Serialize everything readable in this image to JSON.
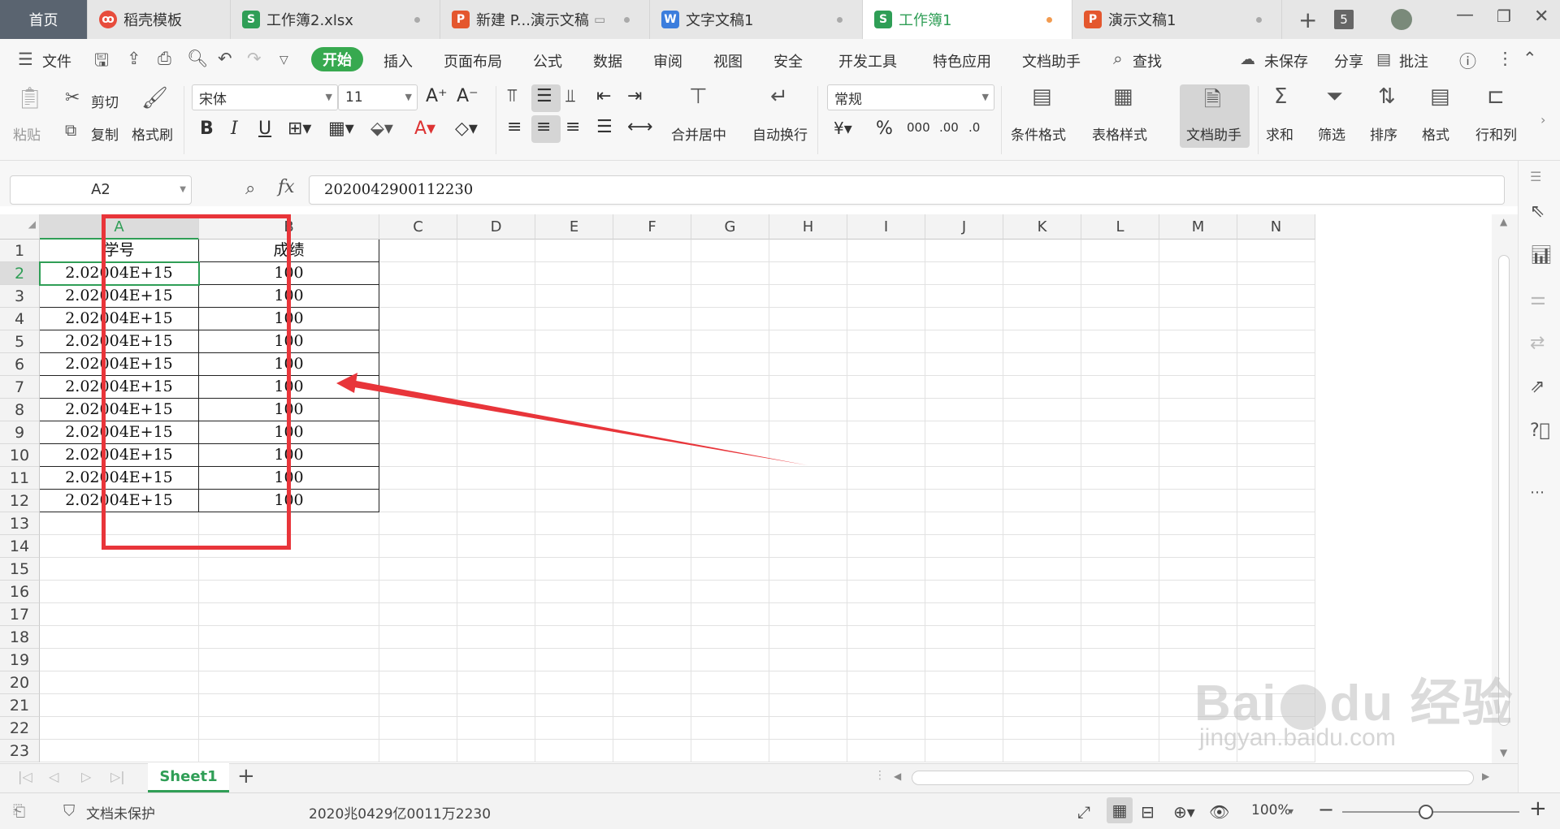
{
  "tabs": [
    {
      "label": "首页",
      "icon": ""
    },
    {
      "label": "稻壳模板",
      "icon": "docer-icon",
      "color": "#e74c3c"
    },
    {
      "label": "工作簿2.xlsx",
      "icon": "S",
      "color": "#2f9e56"
    },
    {
      "label": "新建 P...演示文稿",
      "icon": "P",
      "color": "#e4572e"
    },
    {
      "label": "文字文稿1",
      "icon": "W",
      "color": "#3b7ddd"
    },
    {
      "label": "工作簿1",
      "icon": "S",
      "color": "#2f9e56"
    },
    {
      "label": "演示文稿1",
      "icon": "P",
      "color": "#e4572e"
    }
  ],
  "tab_count": "5",
  "menu": {
    "file": "文件",
    "items": [
      "开始",
      "插入",
      "页面布局",
      "公式",
      "数据",
      "审阅",
      "视图",
      "安全",
      "开发工具",
      "特色应用",
      "文档助手"
    ],
    "search": "查找",
    "unsaved": "未保存",
    "share": "分享",
    "comment": "批注"
  },
  "ribbon": {
    "paste": "粘贴",
    "cut": "剪切",
    "copy": "复制",
    "format_painter": "格式刷",
    "font_name": "宋体",
    "font_size": "11",
    "merge_center": "合并居中",
    "wrap_text": "自动换行",
    "number_format": "常规",
    "conditional_format": "条件格式",
    "table_style": "表格样式",
    "doc_assistant": "文档助手",
    "sum": "求和",
    "filter": "筛选",
    "sort": "排序",
    "format": "格式",
    "rows_cols": "行和列"
  },
  "formula": {
    "name_box": "A2",
    "fx": "fx",
    "value": "2020042900112230"
  },
  "columns": [
    "A",
    "B",
    "C",
    "D",
    "E",
    "F",
    "G",
    "H",
    "I",
    "J",
    "K",
    "L",
    "M",
    "N"
  ],
  "rows": [
    "1",
    "2",
    "3",
    "4",
    "5",
    "6",
    "7",
    "8",
    "9",
    "10",
    "11",
    "12",
    "13",
    "14",
    "15",
    "16",
    "17",
    "18",
    "19",
    "20",
    "21",
    "22",
    "23"
  ],
  "table": {
    "headers": [
      "学号",
      "成绩"
    ],
    "values": [
      [
        "2.02004E+15",
        "100"
      ],
      [
        "2.02004E+15",
        "100"
      ],
      [
        "2.02004E+15",
        "100"
      ],
      [
        "2.02004E+15",
        "100"
      ],
      [
        "2.02004E+15",
        "100"
      ],
      [
        "2.02004E+15",
        "100"
      ],
      [
        "2.02004E+15",
        "100"
      ],
      [
        "2.02004E+15",
        "100"
      ],
      [
        "2.02004E+15",
        "100"
      ],
      [
        "2.02004E+15",
        "100"
      ],
      [
        "2.02004E+15",
        "100"
      ]
    ]
  },
  "sheet": {
    "name": "Sheet1"
  },
  "status": {
    "protection": "文档未保护",
    "readout": "2020兆0429亿0011万2230",
    "zoom": "100%"
  },
  "watermark": {
    "logo": "Baidu 经验",
    "url": "jingyan.baidu.com"
  },
  "colors": {
    "accent": "#2f9e56",
    "annotation": "#e8353a",
    "start_button": "#37a94f"
  }
}
